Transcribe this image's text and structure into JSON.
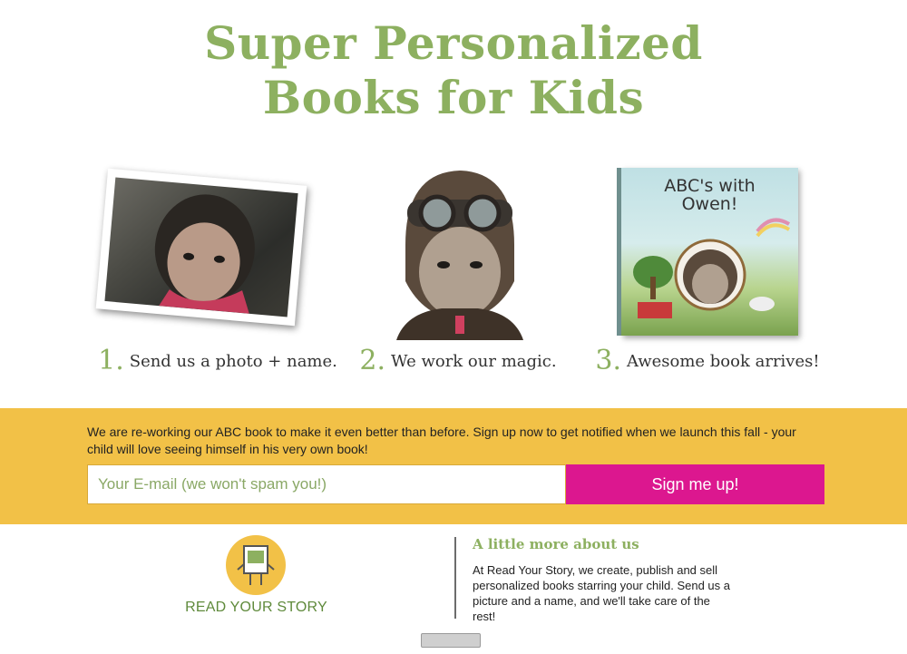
{
  "headline": {
    "line1": "Super Personalized",
    "line2": "Books for Kids"
  },
  "steps": [
    {
      "number": "1.",
      "text": "Send us a photo + name."
    },
    {
      "number": "2.",
      "text": "We work our magic."
    },
    {
      "number": "3.",
      "text": "Awesome book arrives!"
    }
  ],
  "book": {
    "title_line1": "ABC's with",
    "title_line2": "Owen!"
  },
  "signup": {
    "message": "We are re-working our ABC book to make it even better than before. Sign up now to get notified when we launch this fall - your child will love seeing himself in his very own book!",
    "email_placeholder": "Your E-mail (we won't spam you!)",
    "button_label": "Sign me up!"
  },
  "footer": {
    "logo_text": "READ YOUR STORY",
    "about_heading": "A little more about us",
    "about_text": "At Read Your Story, we create, publish and sell personalized books starring your child. Send us a picture and a name, and we'll take care of the rest!"
  },
  "colors": {
    "headline_green": "#8db060",
    "banner_yellow": "#f2c147",
    "button_pink": "#dc178f"
  }
}
